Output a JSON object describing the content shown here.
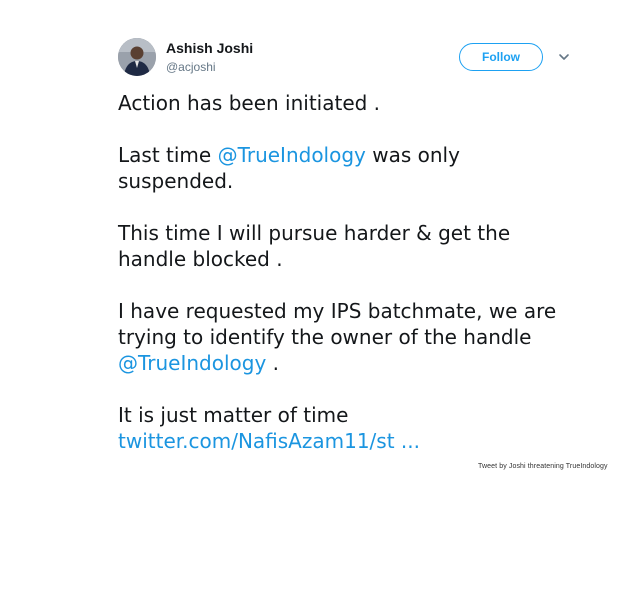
{
  "user": {
    "display_name": "Ashish Joshi",
    "handle": "@acjoshi"
  },
  "actions": {
    "follow_label": "Follow",
    "menu_icon": "chevron-down-icon"
  },
  "tweet": {
    "line1": "Action has been initiated .",
    "p2_prefix": "Last time ",
    "p2_mention": "@TrueIndology",
    "p2_suffix": " was only suspended.",
    "p3": "This time I will pursue harder & get the handle blocked .",
    "p4_text": "I have requested my IPS batchmate, we are trying to identify the owner of the handle ",
    "p4_mention": "@TrueIndology",
    "p4_suffix": " .",
    "p5_text": "It is just matter of time",
    "p5_link": "twitter.com/NafisAzam11/st ..."
  },
  "caption": "Tweet by Joshi threatening TrueIndology",
  "colors": {
    "link": "#1b95e0",
    "follow_border": "#1da1f2",
    "secondary_text": "#657786"
  }
}
